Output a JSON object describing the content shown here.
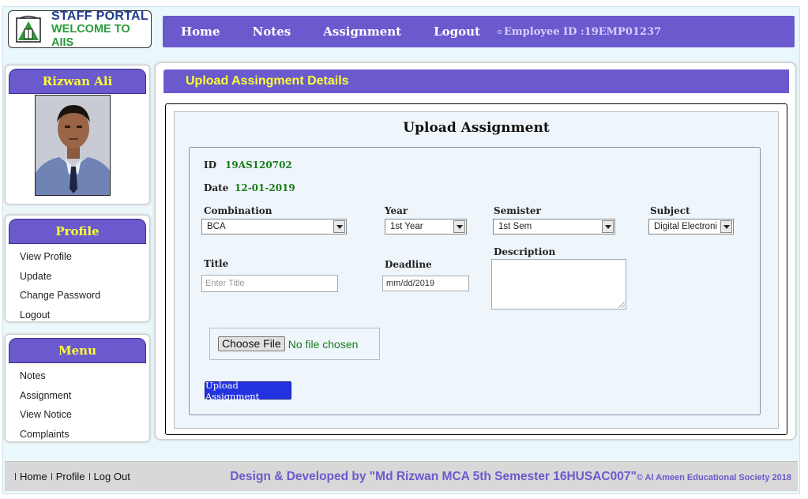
{
  "logo": {
    "line1": "STAFF PORTAL",
    "line2": "WELCOME TO AIIS"
  },
  "topnav": {
    "items": [
      "Home",
      "Notes",
      "Assignment",
      "Logout"
    ],
    "employee": "Employee ID :19EMP01237"
  },
  "profile_card": {
    "name": "Rizwan Ali"
  },
  "profile_menu": {
    "title": "Profile",
    "items": [
      "View Profile",
      "Update",
      "Change Password",
      "Logout"
    ]
  },
  "main_menu": {
    "title": "Menu",
    "items": [
      "Notes",
      "Assignment",
      "View Notice",
      "Complaints"
    ]
  },
  "main": {
    "header": "Upload Assingment Details",
    "form_title": "Upload Assignment",
    "id_label": "ID",
    "id_value": "19AS120702",
    "date_label": "Date",
    "date_value": "12-01-2019",
    "combination_label": "Combination",
    "combination_value": "BCA",
    "year_label": "Year",
    "year_value": "1st Year",
    "semester_label": "Semister",
    "semester_value": "1st Sem",
    "subject_label": "Subject",
    "subject_value": "Digital Electroni",
    "title_label": "Title",
    "title_placeholder": "Enter Title",
    "deadline_label": "Deadline",
    "deadline_value": "mm/dd/2019",
    "description_label": "Description",
    "file_button": "Choose File",
    "file_status": "No file chosen",
    "upload_button": "Upload Assignment"
  },
  "footer": {
    "links": [
      "Home",
      "Profile",
      "Log Out"
    ],
    "credit": "Design & Developed by \"Md Rizwan MCA 5th Semester 16HUSAC007\"",
    "copyright": "© Al Ameen Educational Society 2018",
    "credit_color": "#6a5acd"
  },
  "colors": {
    "accent": "#6a5acd",
    "highlight": "#ffff33",
    "value_green": "#1a7a1a",
    "button_blue": "#2433e0"
  }
}
